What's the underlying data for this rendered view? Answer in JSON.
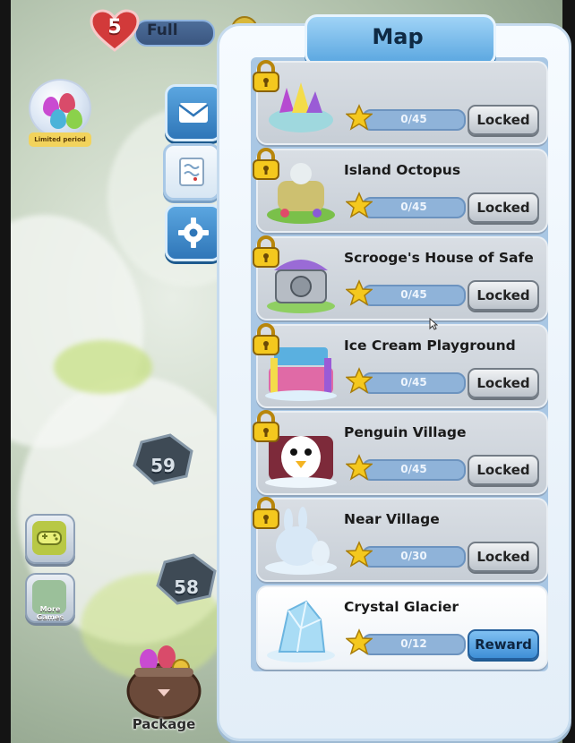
{
  "hud": {
    "lives_count": "5",
    "lives_status": "Full"
  },
  "left_menu": {
    "limited_label": "Limited period",
    "more_games_label": "More Games",
    "package_label": "Package",
    "levels": [
      "59",
      "58"
    ]
  },
  "tabs": [
    {
      "name": "mail",
      "icon": "envelope-icon"
    },
    {
      "name": "map",
      "icon": "map-scroll-icon"
    },
    {
      "name": "settings",
      "icon": "gear-icon"
    }
  ],
  "map": {
    "title": "Map",
    "areas": [
      {
        "name": "",
        "progress": "0/45",
        "stars": 0,
        "max": 45,
        "button": "Locked",
        "locked": true,
        "theme": "crystal-basket"
      },
      {
        "name": "Island Octopus",
        "progress": "0/45",
        "stars": 0,
        "max": 45,
        "button": "Locked",
        "locked": true,
        "theme": "octopus-island"
      },
      {
        "name": "Scrooge's House of Safe",
        "progress": "0/45",
        "stars": 0,
        "max": 45,
        "button": "Locked",
        "locked": true,
        "theme": "safe-house"
      },
      {
        "name": "Ice Cream Playground",
        "progress": "0/45",
        "stars": 0,
        "max": 45,
        "button": "Locked",
        "locked": true,
        "theme": "ice-cream"
      },
      {
        "name": "Penguin Village",
        "progress": "0/45",
        "stars": 0,
        "max": 45,
        "button": "Locked",
        "locked": true,
        "theme": "penguin"
      },
      {
        "name": "Near Village",
        "progress": "0/30",
        "stars": 0,
        "max": 30,
        "button": "Locked",
        "locked": true,
        "theme": "snow-bunny"
      },
      {
        "name": "Crystal Glacier",
        "progress": "0/12",
        "stars": 0,
        "max": 12,
        "button": "Reward",
        "locked": false,
        "theme": "glacier"
      }
    ]
  },
  "colors": {
    "accent_blue": "#3f8fd6",
    "panel_bg": "#e3eef8",
    "star_gold": "#f4c81e",
    "heart_red": "#d23a3a"
  }
}
